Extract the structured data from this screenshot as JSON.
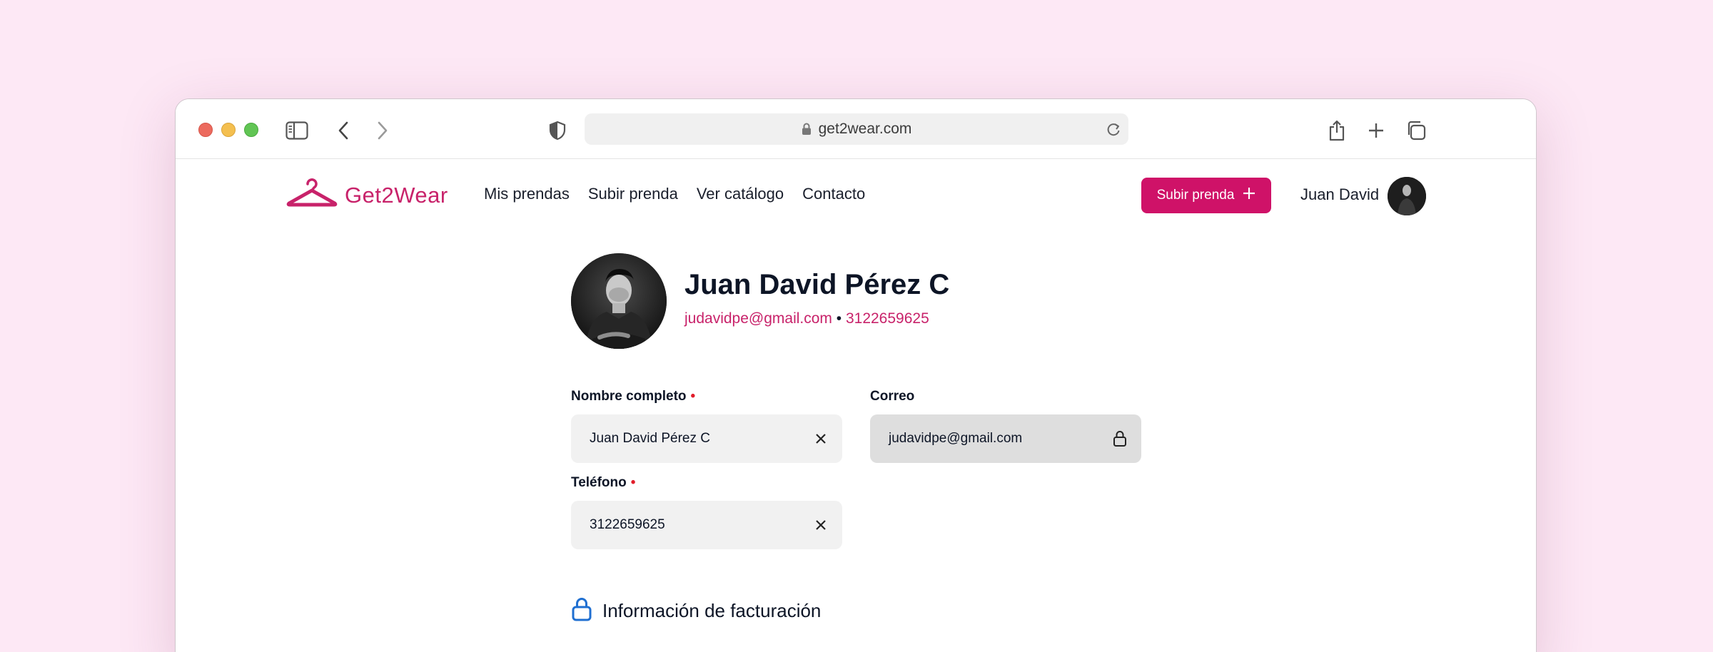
{
  "browser": {
    "url": "get2wear.com"
  },
  "nav": {
    "logo_text": "Get2Wear",
    "links": [
      {
        "label": "Mis prendas"
      },
      {
        "label": "Subir prenda"
      },
      {
        "label": "Ver catálogo"
      },
      {
        "label": "Contacto"
      }
    ],
    "cta_label": "Subir prenda",
    "user_name": "Juan David"
  },
  "profile": {
    "name": "Juan David Pérez C",
    "email": "judavidpe@gmail.com",
    "separator": "•",
    "phone": "3122659625"
  },
  "form": {
    "full_name": {
      "label": "Nombre completo",
      "required_mark": "•",
      "value": "Juan David Pérez C"
    },
    "email": {
      "label": "Correo",
      "value": "judavidpe@gmail.com"
    },
    "phone": {
      "label": "Teléfono",
      "required_mark": "•",
      "value": "3122659625"
    }
  },
  "billing": {
    "title": "Información de facturación"
  },
  "colors": {
    "brand": "#cf1268",
    "background": "#fde8f5",
    "required": "#e11d2a",
    "info_icon": "#1f6fd1"
  }
}
